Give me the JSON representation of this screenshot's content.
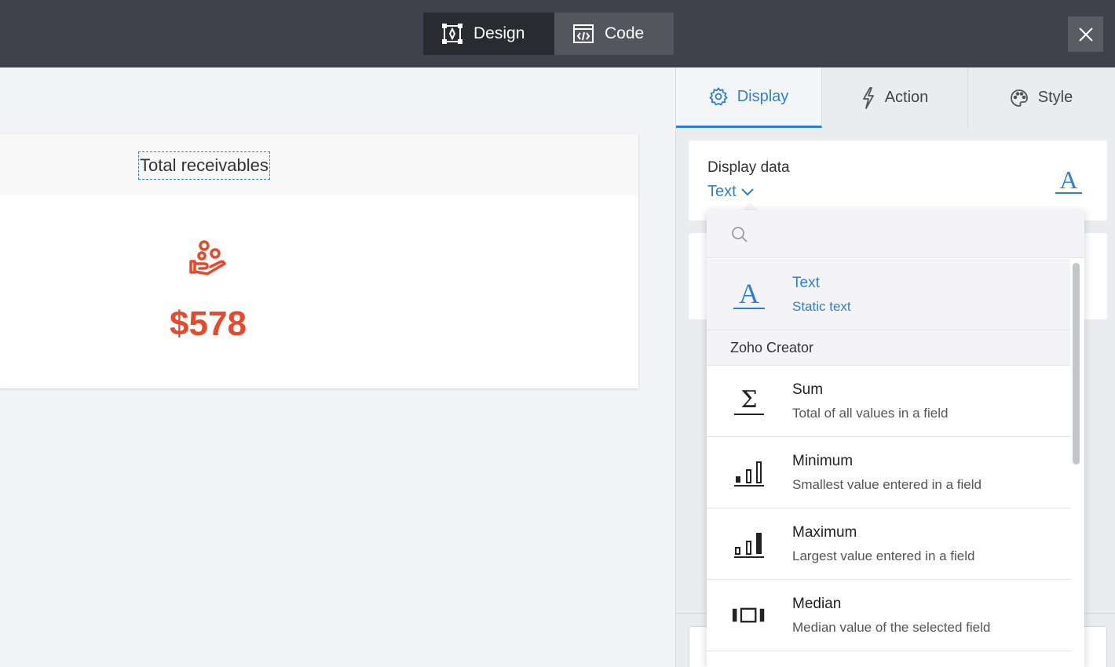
{
  "colors": {
    "accent": "#2f7fd0",
    "value_red": "#e8492a",
    "topbar": "#40424b"
  },
  "topbar": {
    "tabs": [
      {
        "label": "Design",
        "icon": "design-icon"
      },
      {
        "label": "Code",
        "icon": "code-icon"
      }
    ],
    "close_icon": "close-icon"
  },
  "card": {
    "title": "Total receivables",
    "icon": "hand-coins-icon",
    "value": "$578"
  },
  "panel": {
    "tabs": [
      {
        "label": "Display",
        "icon": "gear-icon"
      },
      {
        "label": "Action",
        "icon": "lightning-icon"
      },
      {
        "label": "Style",
        "icon": "palette-icon"
      }
    ],
    "display": {
      "label": "Display data",
      "selected": "Text",
      "glyph": "A"
    }
  },
  "dropdown": {
    "search_placeholder": "",
    "text_option": {
      "glyph": "A",
      "name": "Text",
      "desc": "Static text"
    },
    "group_label": "Zoho Creator",
    "items": [
      {
        "icon": "sum-icon",
        "glyph": "Σ",
        "name": "Sum",
        "desc": "Total of all values in a field"
      },
      {
        "icon": "minimum-icon",
        "name": "Minimum",
        "desc": "Smallest value entered in a field"
      },
      {
        "icon": "maximum-icon",
        "name": "Maximum",
        "desc": "Largest value entered in a field"
      },
      {
        "icon": "median-icon",
        "name": "Median",
        "desc": "Median value of the selected field"
      }
    ]
  }
}
